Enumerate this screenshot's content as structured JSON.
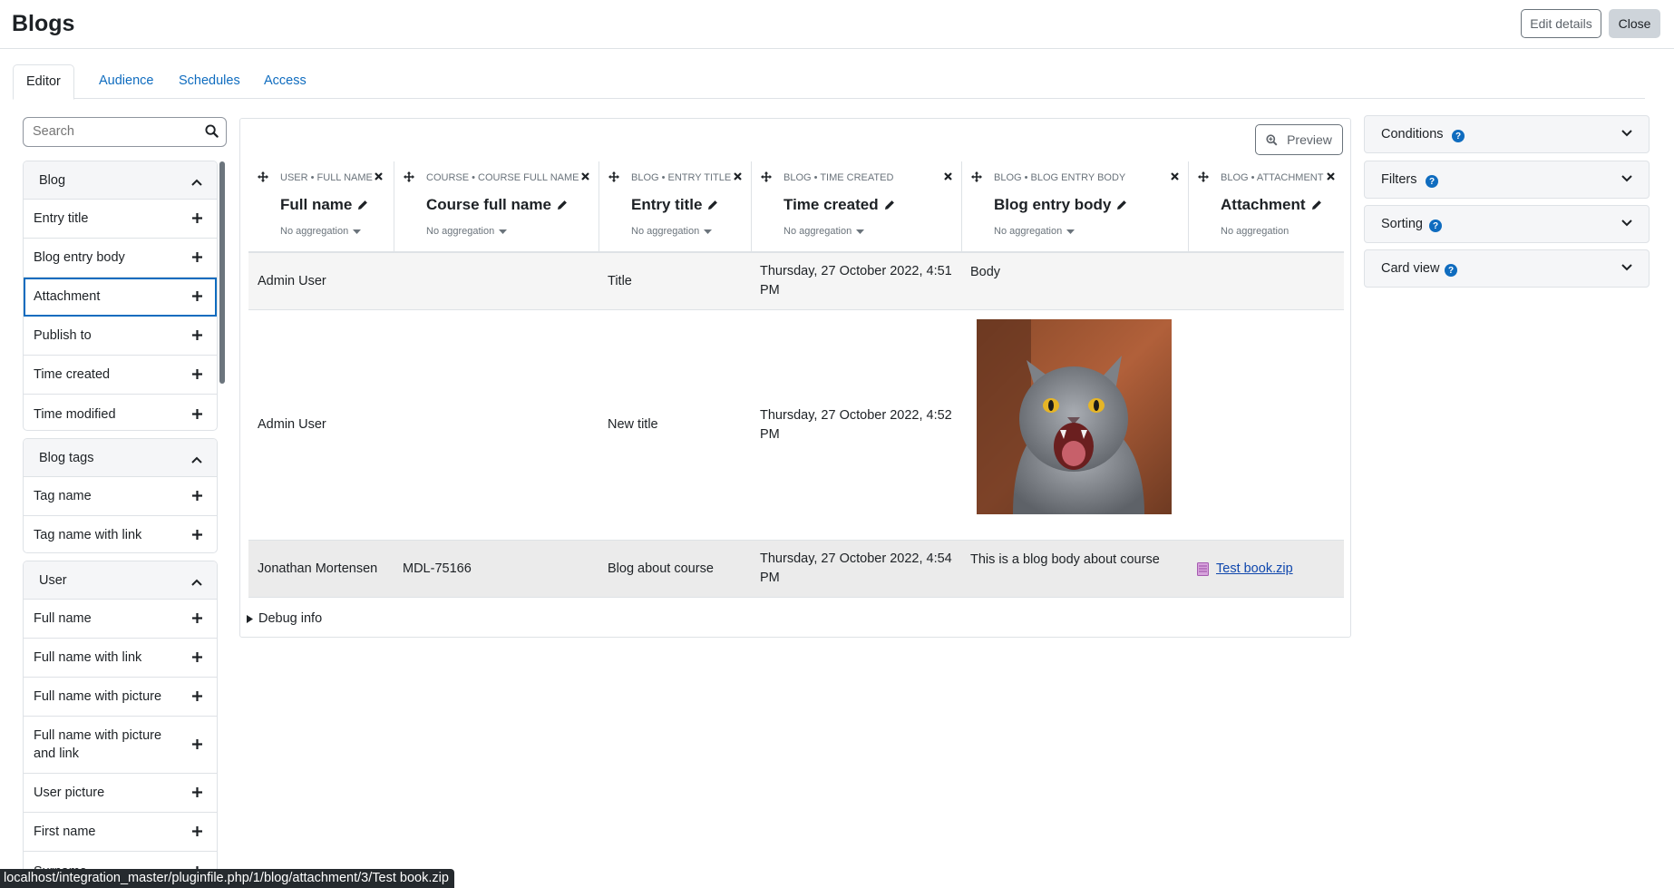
{
  "header": {
    "title": "Blogs",
    "edit_label": "Edit details",
    "close_label": "Close"
  },
  "tabs": [
    {
      "label": "Editor"
    },
    {
      "label": "Audience"
    },
    {
      "label": "Schedules"
    },
    {
      "label": "Access"
    }
  ],
  "sidebar": {
    "search_placeholder": "Search",
    "groups": [
      {
        "title": "Blog",
        "items": [
          "Entry title",
          "Blog entry body",
          "Attachment",
          "Publish to",
          "Time created",
          "Time modified"
        ]
      },
      {
        "title": "Blog tags",
        "items": [
          "Tag name",
          "Tag name with link"
        ]
      },
      {
        "title": "User",
        "items": [
          "Full name",
          "Full name with link",
          "Full name with picture",
          "Full name with picture and link",
          "User picture",
          "First name",
          "Surname"
        ]
      }
    ]
  },
  "preview_label": "Preview",
  "columns": [
    {
      "caption": "USER • FULL NAME",
      "title": "Full name",
      "aggregation": "No aggregation"
    },
    {
      "caption": "COURSE • COURSE FULL NAME",
      "title": "Course full name",
      "aggregation": "No aggregation"
    },
    {
      "caption": "BLOG • ENTRY TITLE",
      "title": "Entry title",
      "aggregation": "No aggregation"
    },
    {
      "caption": "BLOG • TIME CREATED",
      "title": "Time created",
      "aggregation": "No aggregation"
    },
    {
      "caption": "BLOG • BLOG ENTRY BODY",
      "title": "Blog entry body",
      "aggregation": "No aggregation"
    },
    {
      "caption": "BLOG • ATTACHMENT",
      "title": "Attachment",
      "aggregation": "No aggregation"
    }
  ],
  "rows": [
    {
      "full_name": "Admin User",
      "course": "",
      "entry_title": "Title",
      "time_created_1": "Thursday, 27 October 2022, 4:51",
      "time_created_2": "PM",
      "body": "Body",
      "attachment": ""
    },
    {
      "full_name": "Admin User",
      "course": "",
      "entry_title": "New title",
      "time_created_1": "Thursday, 27 October 2022, 4:52",
      "time_created_2": "PM",
      "body": "",
      "attachment": ""
    },
    {
      "full_name": "Jonathan Mortensen",
      "course": "MDL-75166",
      "entry_title": "Blog about course",
      "time_created_1": "Thursday, 27 October 2022, 4:54",
      "time_created_2": "PM",
      "body": "This is a blog body about course",
      "attachment": "Test book.zip"
    }
  ],
  "debug_label": "Debug info",
  "right_panel": [
    {
      "label": "Conditions"
    },
    {
      "label": "Filters"
    },
    {
      "label": "Sorting"
    },
    {
      "label": "Card view"
    }
  ],
  "status_bar": "localhost/integration_master/pluginfile.php/1/blog/attachment/3/Test book.zip",
  "colors": {
    "link": "#0f6cbf",
    "help_icon": "#0f6cbf",
    "selected_outline": "#0f6cbf"
  }
}
